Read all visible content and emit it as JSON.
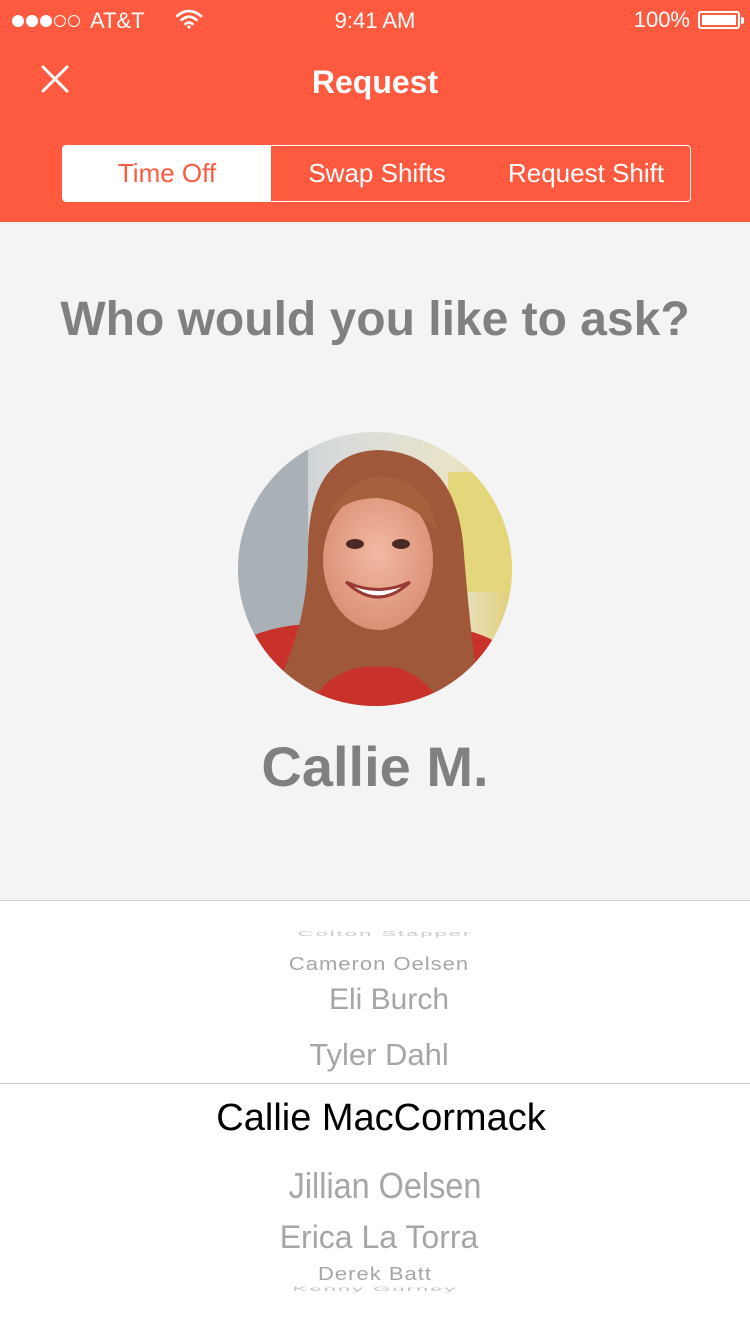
{
  "status_bar": {
    "signal_filled": 3,
    "signal_total": 5,
    "carrier": "AT&T",
    "time": "9:41 AM",
    "battery": "100%",
    "battery_level": 1.0
  },
  "nav": {
    "title": "Request",
    "close_icon": "close-icon"
  },
  "tabs": [
    {
      "label": "Time Off",
      "active": true
    },
    {
      "label": "Swap Shifts",
      "active": false
    },
    {
      "label": "Request Shift",
      "active": false
    }
  ],
  "main": {
    "question": "Who would you like to ask?",
    "selected_person": "Callie M."
  },
  "picker": {
    "items": [
      "Colton Stapper",
      "Cameron Oelsen",
      "Eli Burch",
      "Tyler Dahl",
      "Callie MacCormack",
      "Jillian Oelsen",
      "Erica La Torra",
      "Derek Batt",
      "Kenny Gurney"
    ],
    "selected_index": 4
  },
  "colors": {
    "accent": "#fe5a3f",
    "background": "#f4f4f4",
    "muted_text": "#808080"
  }
}
